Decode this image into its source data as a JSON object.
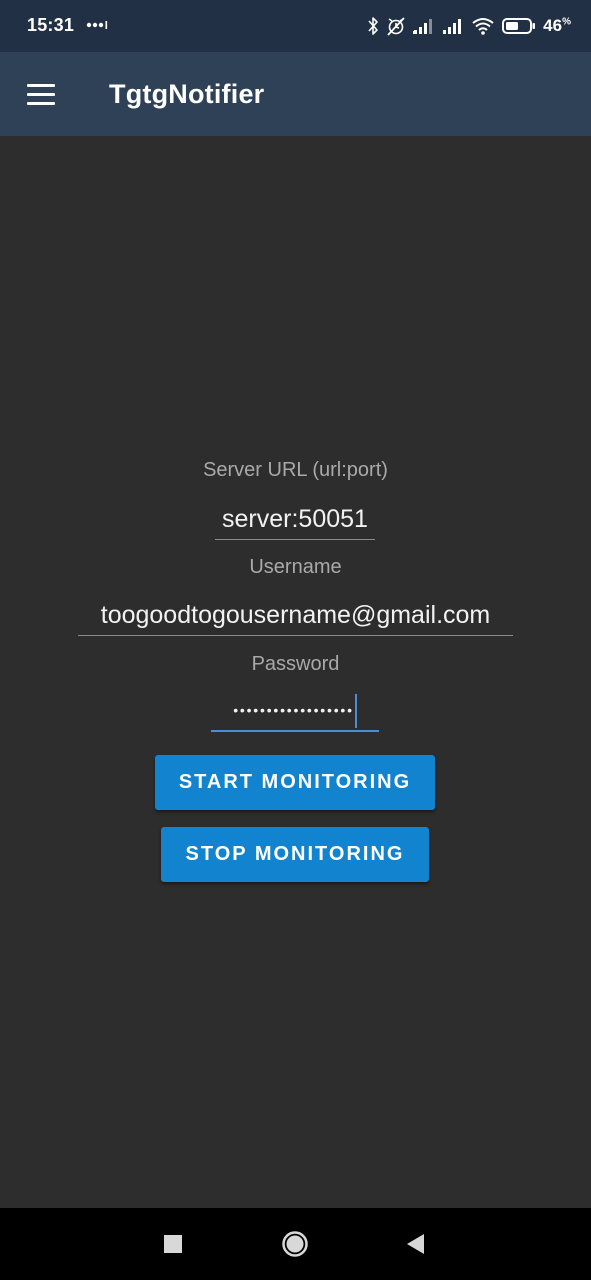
{
  "status_bar": {
    "time": "15:31",
    "battery_percent": "46",
    "battery_unit": "%",
    "icons": [
      "dots-icon",
      "bluetooth-icon",
      "alarm-off-icon",
      "signal-icon",
      "signal-icon",
      "wifi-icon",
      "battery-icon"
    ]
  },
  "app_bar": {
    "title": "TgtgNotifier",
    "menu_icon": "hamburger-menu-icon"
  },
  "form": {
    "server_url": {
      "label": "Server URL (url:port)",
      "value": "server:50051"
    },
    "username": {
      "label": "Username",
      "value": "toogoodtogousername@gmail.com"
    },
    "password": {
      "label": "Password",
      "value_masked": "••••••••••••••••••"
    },
    "start_button": "START MONITORING",
    "stop_button": "STOP MONITORING"
  },
  "nav_bar": {
    "items": [
      "recents-square-icon",
      "home-circle-icon",
      "back-triangle-icon"
    ]
  },
  "colors": {
    "status_bar": "#213044",
    "app_bar": "#2e4156",
    "background": "#2d2d2d",
    "button": "#1183cf",
    "focus_accent": "#4a8fd6"
  }
}
